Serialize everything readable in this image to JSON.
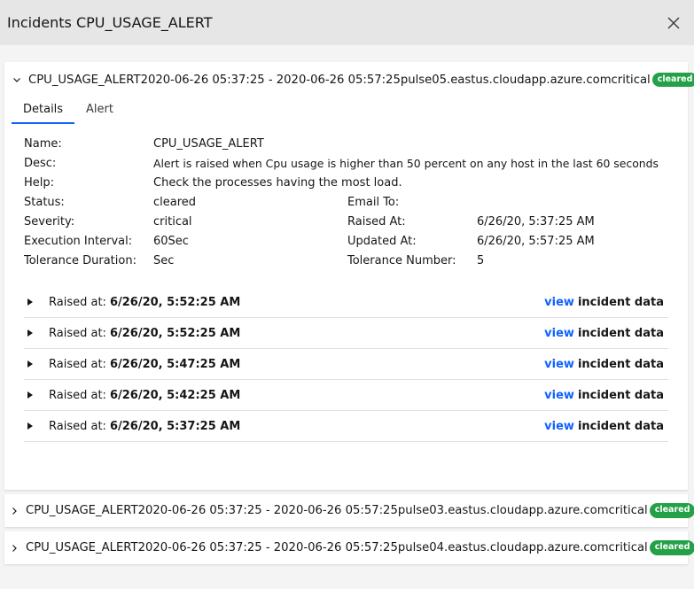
{
  "modal": {
    "title": "Incidents CPU_USAGE_ALERT"
  },
  "expanded": {
    "header": {
      "name": "CPU_USAGE_ALERT",
      "range": "2020-06-26 05:37:25 - 2020-06-26 05:57:25",
      "host": "pulse05.eastus.cloudapp.azure.com",
      "severity": "critical",
      "badge": "cleared"
    },
    "tabs": [
      "Details",
      "Alert"
    ],
    "details": {
      "name_label": "Name:",
      "name_value": "CPU_USAGE_ALERT",
      "desc_label": "Desc:",
      "desc_value": "Alert is raised when Cpu usage is higher than 50 percent on any host in the last 60 seconds",
      "help_label": "Help:",
      "help_value": "Check the processes having the most load.",
      "status_label": "Status:",
      "status_value": "cleared",
      "severity_label": "Severity:",
      "severity_value": "critical",
      "exec_label": "Execution Interval:",
      "exec_value": "60Sec",
      "tol_dur_label": "Tolerance Duration:",
      "tol_dur_value": "Sec",
      "email_label": "Email To:",
      "email_value": "",
      "raised_label": "Raised At:",
      "raised_value": "6/26/20, 5:37:25 AM",
      "updated_label": "Updated At:",
      "updated_value": "6/26/20, 5:57:25 AM",
      "tol_num_label": "Tolerance Number:",
      "tol_num_value": "5"
    },
    "incidents": [
      {
        "prefix": "Raised at:",
        "time": "6/26/20, 5:52:25 AM",
        "view": "view",
        "suffix": "incident data"
      },
      {
        "prefix": "Raised at:",
        "time": "6/26/20, 5:52:25 AM",
        "view": "view",
        "suffix": "incident data"
      },
      {
        "prefix": "Raised at:",
        "time": "6/26/20, 5:47:25 AM",
        "view": "view",
        "suffix": "incident data"
      },
      {
        "prefix": "Raised at:",
        "time": "6/26/20, 5:42:25 AM",
        "view": "view",
        "suffix": "incident data"
      },
      {
        "prefix": "Raised at:",
        "time": "6/26/20, 5:37:25 AM",
        "view": "view",
        "suffix": "incident data"
      }
    ]
  },
  "collapsed": [
    {
      "name": "CPU_USAGE_ALERT",
      "range": "2020-06-26 05:37:25 - 2020-06-26 05:57:25",
      "host": "pulse03.eastus.cloudapp.azure.com",
      "severity": "critical",
      "badge": "cleared"
    },
    {
      "name": "CPU_USAGE_ALERT",
      "range": "2020-06-26 05:37:25 - 2020-06-26 05:57:25",
      "host": "pulse04.eastus.cloudapp.azure.com",
      "severity": "critical",
      "badge": "cleared"
    }
  ],
  "icons": {
    "close": "close-icon",
    "expand": "chevron-down-icon",
    "collapse": "chevron-right-icon",
    "row_toggle": "caret-right-icon"
  },
  "colors": {
    "badge": "#24a148",
    "link": "#0f62fe",
    "tab_active": "#0f62fe",
    "header_bg": "#e6e6e6"
  }
}
